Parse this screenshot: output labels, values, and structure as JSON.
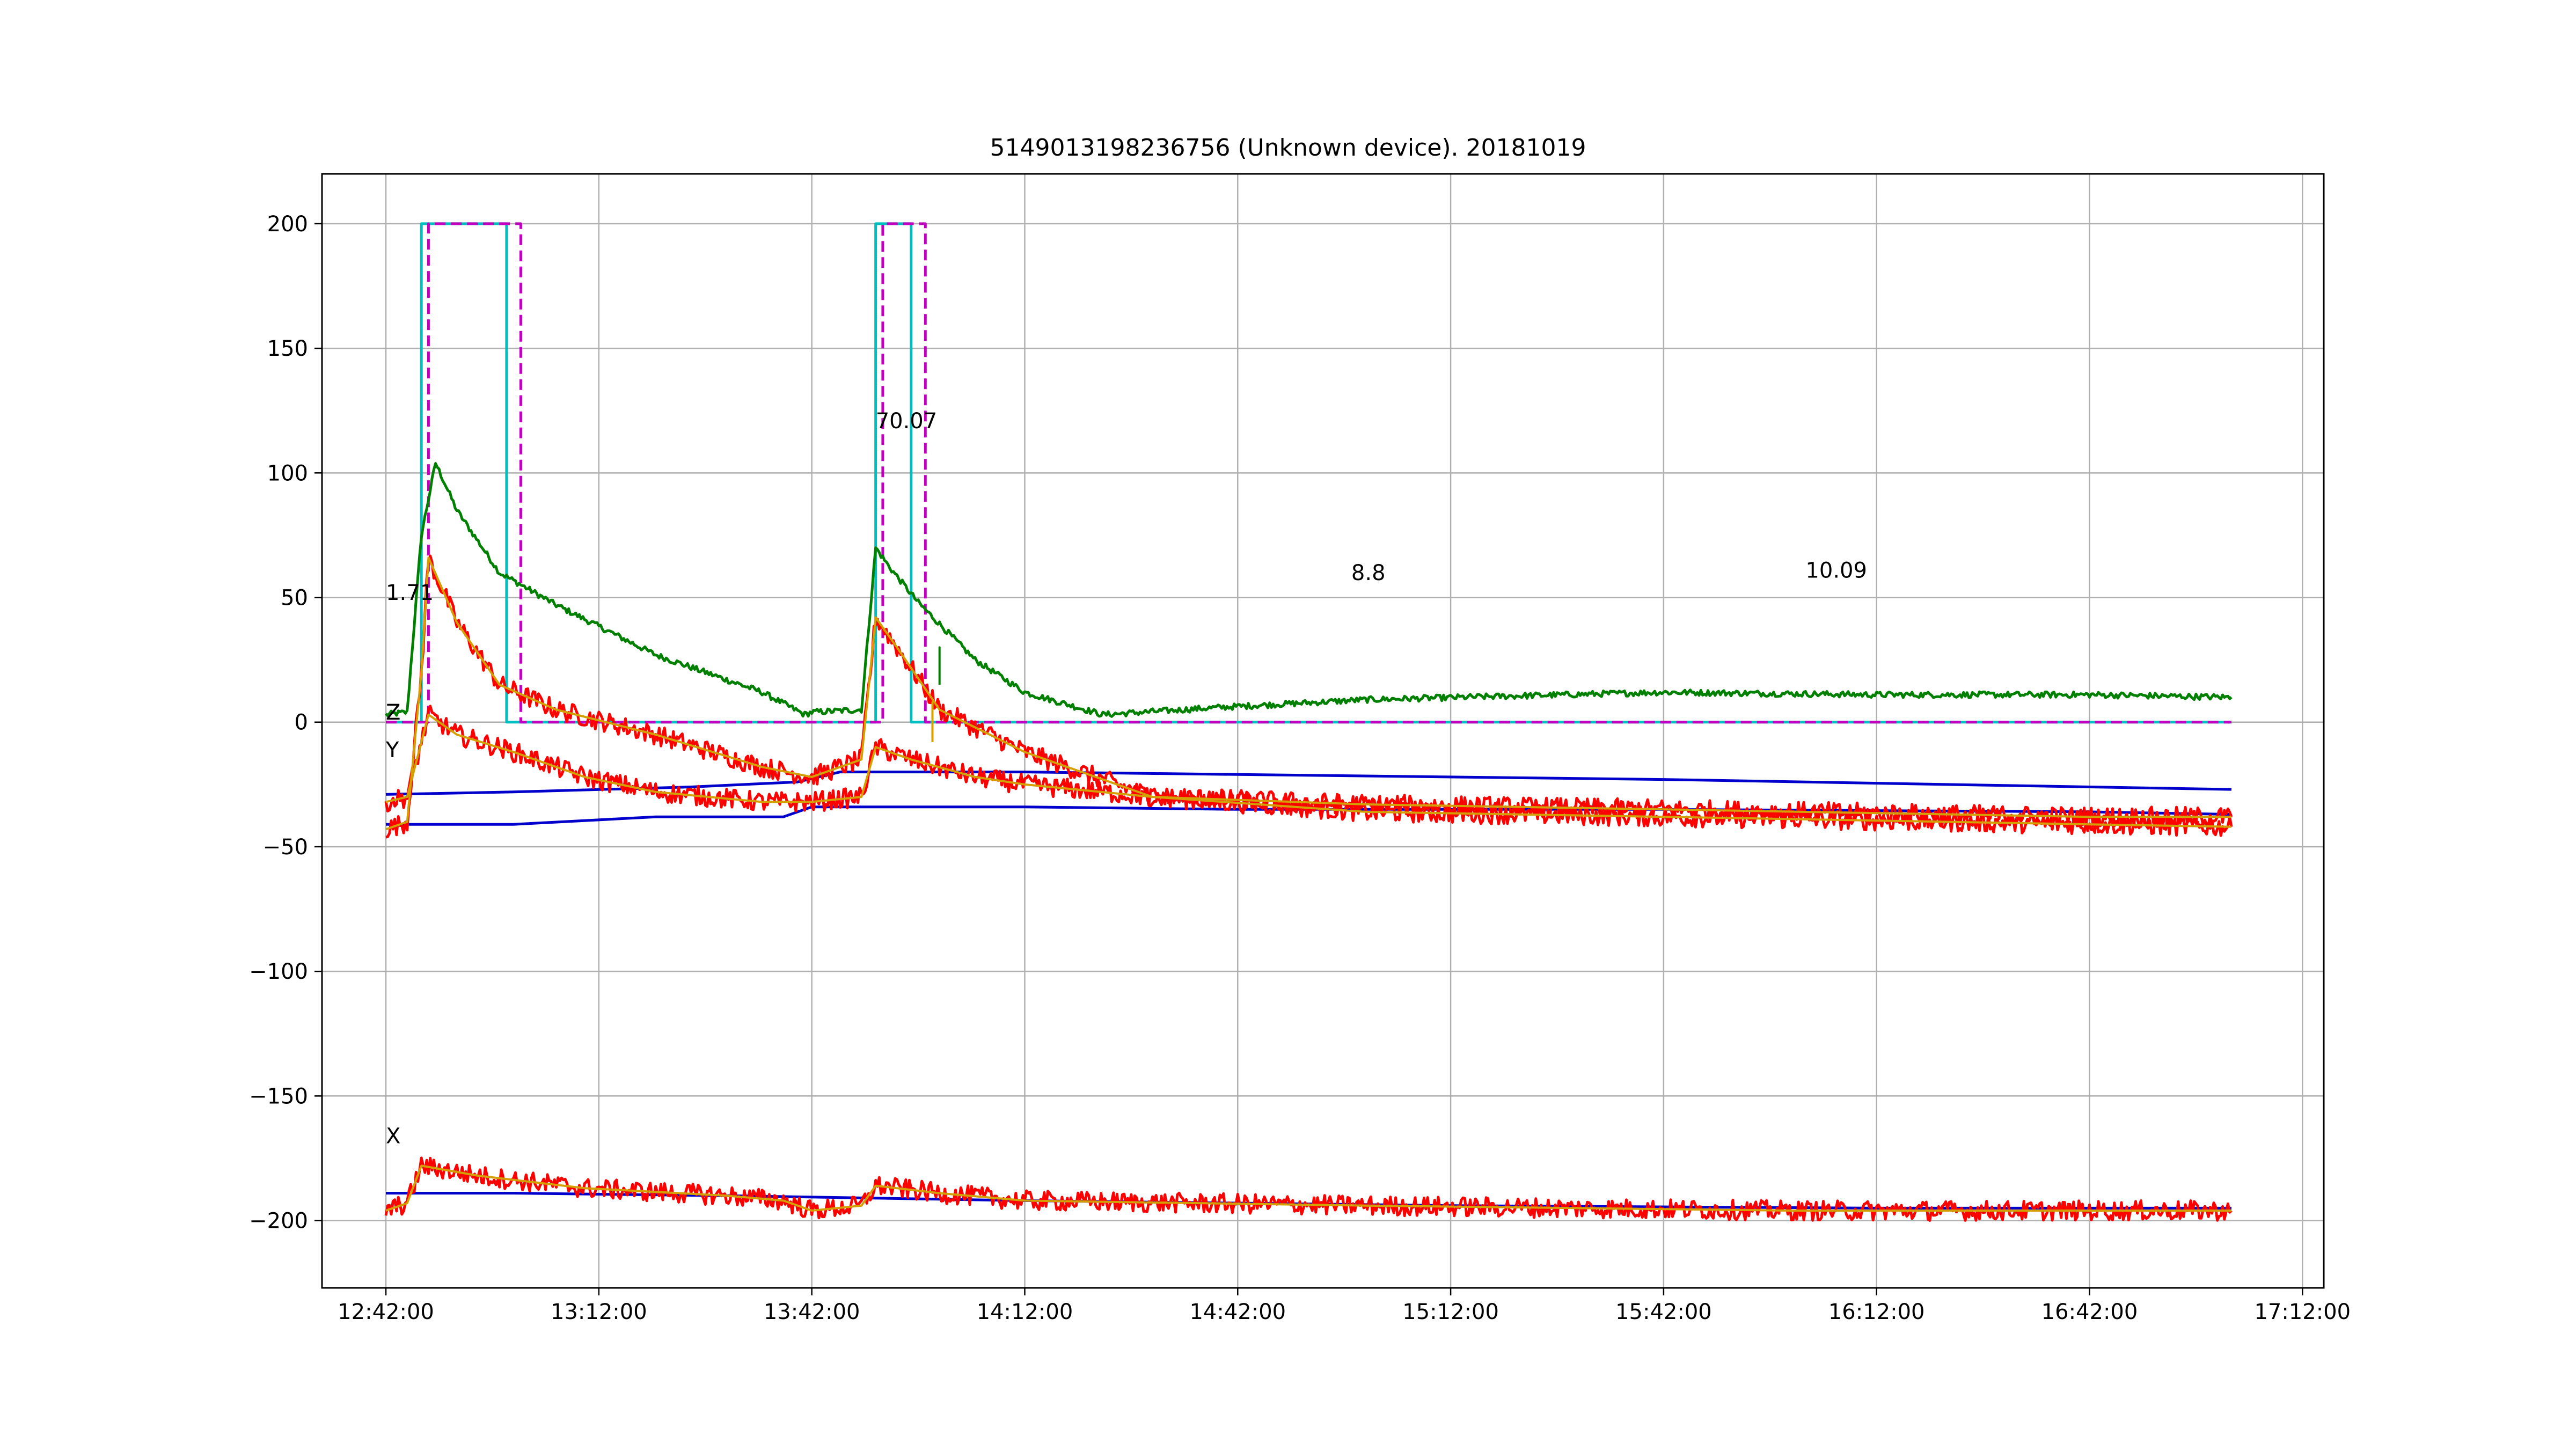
{
  "chart_data": {
    "type": "line",
    "title": "5149013198236756 (Unknown device). 20181019",
    "xlabel": "",
    "ylabel": "",
    "x_range": [
      "12:33:00",
      "17:15:00"
    ],
    "ylim": [
      -227,
      220
    ],
    "grid": true,
    "x_ticks": [
      "12:42:00",
      "13:12:00",
      "13:42:00",
      "14:12:00",
      "14:42:00",
      "15:12:00",
      "15:42:00",
      "16:12:00",
      "16:42:00",
      "17:12:00"
    ],
    "y_ticks": [
      200,
      150,
      100,
      50,
      0,
      -50,
      -100,
      -150,
      -200
    ],
    "y_tick_labels": [
      "200",
      "150",
      "100",
      "50",
      "0",
      "−50",
      "−100",
      "−150",
      "−200"
    ],
    "annotations": [
      {
        "text": "1.71",
        "x": "12:42:00",
        "y": 52
      },
      {
        "text": "70.07",
        "x": "13:51:00",
        "y": 121
      },
      {
        "text": "8.8",
        "x": "14:58:00",
        "y": 60
      },
      {
        "text": "10.09",
        "x": "16:02:00",
        "y": 61
      },
      {
        "text": "Z",
        "x": "12:42:00",
        "y": 4
      },
      {
        "text": "Y",
        "x": "12:42:00",
        "y": -11
      },
      {
        "text": "X",
        "x": "12:42:00",
        "y": -166
      }
    ],
    "series": [
      {
        "color": "#00bfbf",
        "style": "solid",
        "width": 5,
        "x": [
          "12:42:00",
          "12:47:00",
          "12:47:00",
          "12:59:00",
          "12:59:00",
          "13:51:00",
          "13:51:00",
          "13:56:00",
          "13:56:00",
          "17:02:00"
        ],
        "y": [
          0,
          0,
          200,
          200,
          0,
          0,
          200,
          200,
          0,
          0
        ]
      },
      {
        "color": "#bf00bf",
        "style": "dashed",
        "width": 5,
        "x": [
          "12:42:00",
          "12:48:00",
          "12:48:00",
          "13:01:00",
          "13:01:00",
          "13:52:00",
          "13:52:00",
          "13:58:00",
          "13:58:00",
          "17:02:00"
        ],
        "y": [
          0,
          0,
          200,
          200,
          0,
          0,
          200,
          200,
          0,
          0
        ]
      },
      {
        "color": "#008000",
        "style": "solid",
        "width": 5,
        "noise": 1.2,
        "x": [
          "12:42:00",
          "12:45:00",
          "12:47:00",
          "12:49:00",
          "12:52:00",
          "12:58:00",
          "13:06:00",
          "13:20:00",
          "13:35:00",
          "13:41:00",
          "13:42:00",
          "13:49:00",
          "13:51:00",
          "13:53:00",
          "13:57:00",
          "14:05:00",
          "14:12:00",
          "14:23:00",
          "14:40:00",
          "15:00:00",
          "15:42:00",
          "16:12:00",
          "16:42:00",
          "17:02:00"
        ],
        "y": [
          3,
          4,
          75,
          104,
          85,
          60,
          47,
          27,
          12,
          3,
          4,
          5,
          70,
          62,
          48,
          25,
          12,
          3,
          6,
          9,
          12,
          11,
          11,
          10
        ]
      },
      {
        "color": "#0000cc",
        "style": "solid",
        "width": 5,
        "x": [
          "12:42:00",
          "13:00:00",
          "13:25:00",
          "13:40:00",
          "13:46:00",
          "14:12:00",
          "14:42:00",
          "15:42:00",
          "16:42:00",
          "17:02:00"
        ],
        "y": [
          -29,
          -28,
          -26,
          -24,
          -20,
          -20,
          -21,
          -23,
          -26,
          -27
        ]
      },
      {
        "color": "#0000cc",
        "style": "solid",
        "width": 5,
        "x": [
          "12:42:00",
          "13:00:00",
          "13:20:00",
          "13:38:00",
          "13:42:00",
          "14:12:00",
          "14:42:00",
          "15:42:00",
          "16:42:00",
          "17:02:00"
        ],
        "y": [
          -41,
          -41,
          -38,
          -38,
          -34,
          -34,
          -35,
          -35,
          -36,
          -37
        ]
      },
      {
        "color": "#0000cc",
        "style": "solid",
        "width": 5,
        "x": [
          "12:42:00",
          "13:00:00",
          "13:30:00",
          "14:12:00",
          "15:12:00",
          "16:12:00",
          "17:02:00"
        ],
        "y": [
          -189,
          -189,
          -190,
          -192,
          -194,
          -195,
          -195
        ]
      },
      {
        "color": "#ff0000",
        "style": "solid",
        "width": 5,
        "noise": 4,
        "x": [
          "12:42:00",
          "12:45:00",
          "12:47:00",
          "12:48:00",
          "12:52:00",
          "12:58:00",
          "13:06:00",
          "13:20:00",
          "13:35:00",
          "13:42:00",
          "13:49:00",
          "13:51:00",
          "13:54:00",
          "14:00:00",
          "14:12:00",
          "14:30:00",
          "15:00:00",
          "15:42:00",
          "16:42:00",
          "17:02:00"
        ],
        "y": [
          -43,
          -40,
          20,
          66,
          40,
          15,
          5,
          -5,
          -18,
          -22,
          -15,
          42,
          30,
          5,
          -12,
          -30,
          -36,
          -38,
          -41,
          -42
        ]
      },
      {
        "color": "#ff0000",
        "style": "solid",
        "width": 5,
        "noise": 4,
        "x": [
          "12:42:00",
          "12:45:00",
          "12:48:00",
          "12:52:00",
          "13:00:00",
          "13:10:00",
          "13:20:00",
          "13:35:00",
          "13:42:00",
          "13:49:00",
          "13:51:00",
          "13:56:00",
          "14:05:00",
          "14:12:00",
          "14:30:00",
          "15:00:00",
          "15:42:00",
          "16:42:00",
          "17:02:00"
        ],
        "y": [
          -32,
          -30,
          3,
          -5,
          -12,
          -22,
          -28,
          -32,
          -32,
          -30,
          -10,
          -15,
          -22,
          -25,
          -30,
          -33,
          -35,
          -38,
          -38
        ]
      },
      {
        "color": "#ff0000",
        "style": "solid",
        "width": 5,
        "noise": 4,
        "x": [
          "12:42:00",
          "12:45:00",
          "12:47:00",
          "12:55:00",
          "13:10:00",
          "13:30:00",
          "13:38:00",
          "13:42:00",
          "13:49:00",
          "13:51:00",
          "14:00:00",
          "14:12:00",
          "15:00:00",
          "16:00:00",
          "17:02:00"
        ],
        "y": [
          -196,
          -193,
          -178,
          -182,
          -187,
          -190,
          -192,
          -196,
          -194,
          -186,
          -189,
          -192,
          -194,
          -196,
          -196
        ]
      },
      {
        "color": "#d4a000",
        "style": "solid",
        "width": 4,
        "x": [
          "12:42:00",
          "12:45:00",
          "12:47:00",
          "12:48:00",
          "12:52:00",
          "12:58:00",
          "13:06:00",
          "13:20:00",
          "13:35:00",
          "13:42:00",
          "13:49:00",
          "13:51:00",
          "13:54:00",
          "14:00:00",
          "14:12:00",
          "14:30:00",
          "15:00:00",
          "15:42:00",
          "16:42:00",
          "17:02:00"
        ],
        "y": [
          -43,
          -40,
          20,
          66,
          40,
          15,
          5,
          -5,
          -18,
          -22,
          -15,
          42,
          30,
          5,
          -12,
          -30,
          -36,
          -38,
          -41,
          -42
        ]
      },
      {
        "color": "#d4a000",
        "style": "solid",
        "width": 4,
        "x": [
          "12:42:00",
          "12:45:00",
          "12:48:00",
          "12:52:00",
          "13:00:00",
          "13:10:00",
          "13:20:00",
          "13:35:00",
          "13:42:00",
          "13:49:00",
          "13:51:00",
          "13:56:00",
          "14:05:00",
          "14:12:00",
          "14:30:00",
          "15:00:00",
          "15:42:00",
          "16:42:00",
          "17:02:00"
        ],
        "y": [
          -32,
          -30,
          3,
          -5,
          -12,
          -22,
          -28,
          -32,
          -32,
          -30,
          -10,
          -15,
          -22,
          -25,
          -30,
          -33,
          -35,
          -38,
          -38
        ]
      },
      {
        "color": "#d4a000",
        "style": "solid",
        "width": 4,
        "x": [
          "12:42:00",
          "12:45:00",
          "12:47:00",
          "12:55:00",
          "13:10:00",
          "13:30:00",
          "13:38:00",
          "13:42:00",
          "13:49:00",
          "13:51:00",
          "14:00:00",
          "14:12:00",
          "15:00:00",
          "16:00:00",
          "17:02:00"
        ],
        "y": [
          -196,
          -193,
          -178,
          -182,
          -187,
          -190,
          -192,
          -196,
          -194,
          -186,
          -189,
          -192,
          -194,
          -196,
          -196
        ]
      },
      {
        "color": "#d4a000",
        "style": "solid",
        "width": 4,
        "x": [
          "13:59:00",
          "13:59:00",
          "13:59:00"
        ],
        "y": [
          -8,
          8,
          -8
        ]
      },
      {
        "color": "#008000",
        "style": "solid",
        "width": 4,
        "x": [
          "14:00:00",
          "14:00:00",
          "14:00:00"
        ],
        "y": [
          15,
          30,
          15
        ]
      }
    ]
  }
}
